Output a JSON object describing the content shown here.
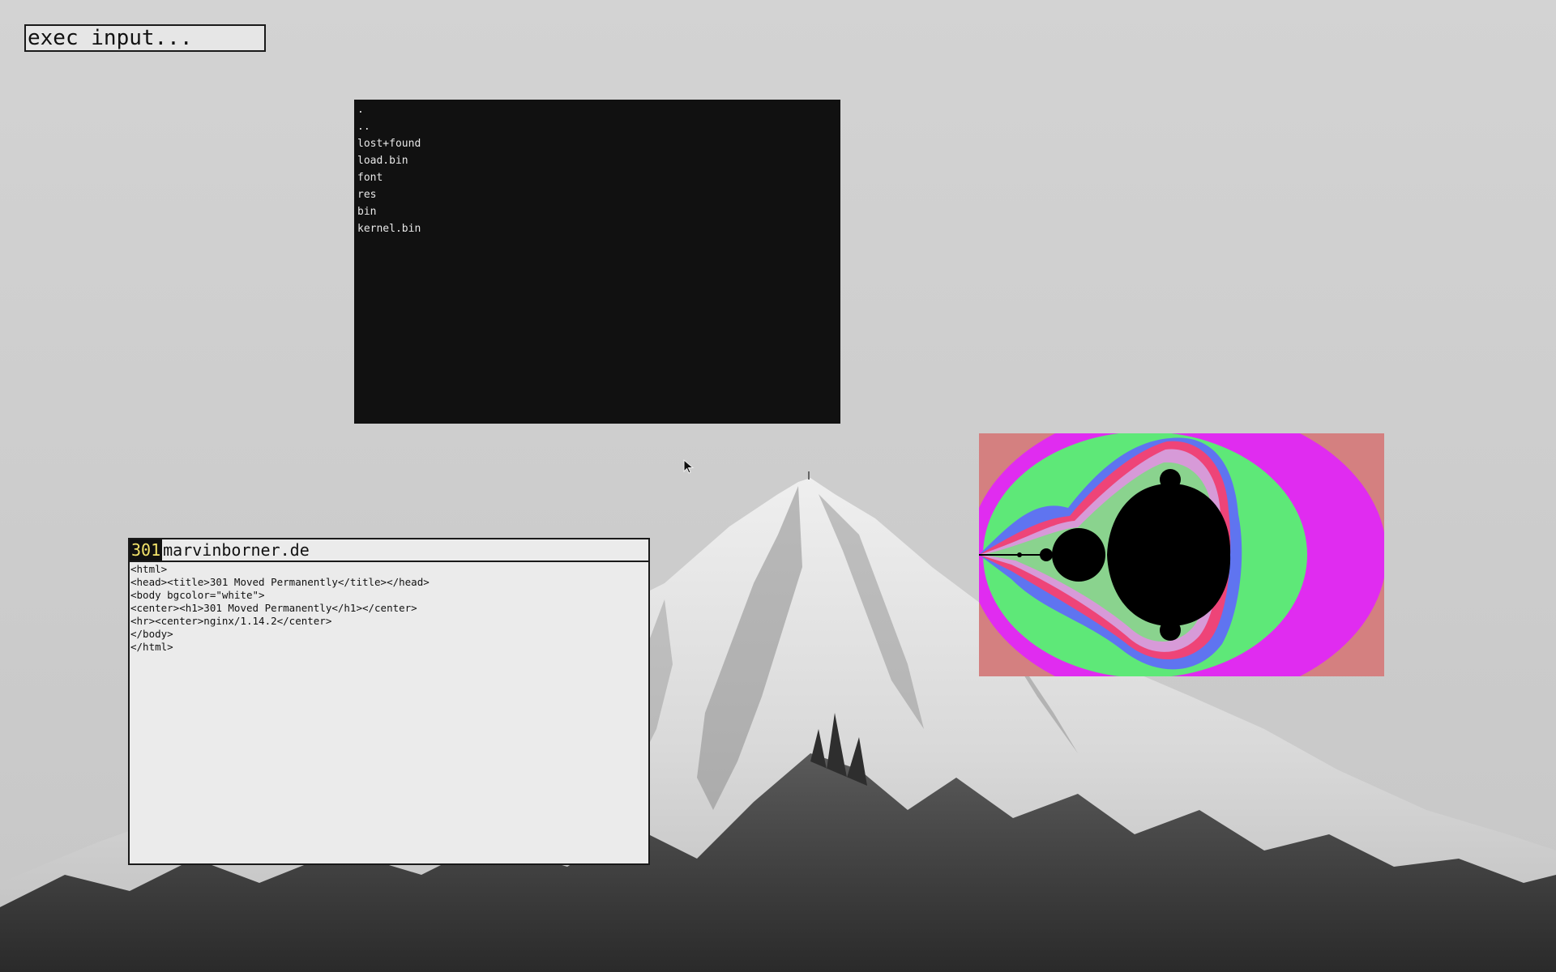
{
  "exec": {
    "placeholder": "exec input..."
  },
  "file_browser": {
    "entries": [
      ".",
      "..",
      "lost+found",
      "load.bin",
      "font",
      "res",
      "bin",
      "kernel.bin"
    ]
  },
  "browser": {
    "status_code": "301",
    "url": "marvinborner.de",
    "source_lines": [
      "<html>",
      "<head><title>301 Moved Permanently</title></head>",
      "<body bgcolor=\"white\">",
      "<center><h1>301 Moved Permanently</h1></center>",
      "<hr><center>nginx/1.14.2</center>",
      "</body>",
      "</html>"
    ]
  },
  "colors": {
    "terminal_bg": "#111111",
    "status_code_fg": "#f3e36a",
    "fractal_outer": "#d48080",
    "fractal_magenta": "#e02cf0",
    "fractal_green": "#5ee878",
    "fractal_blue": "#5f74f0",
    "fractal_pink": "#ee4478"
  },
  "icons": {
    "cursor": "mouse-pointer-icon"
  }
}
